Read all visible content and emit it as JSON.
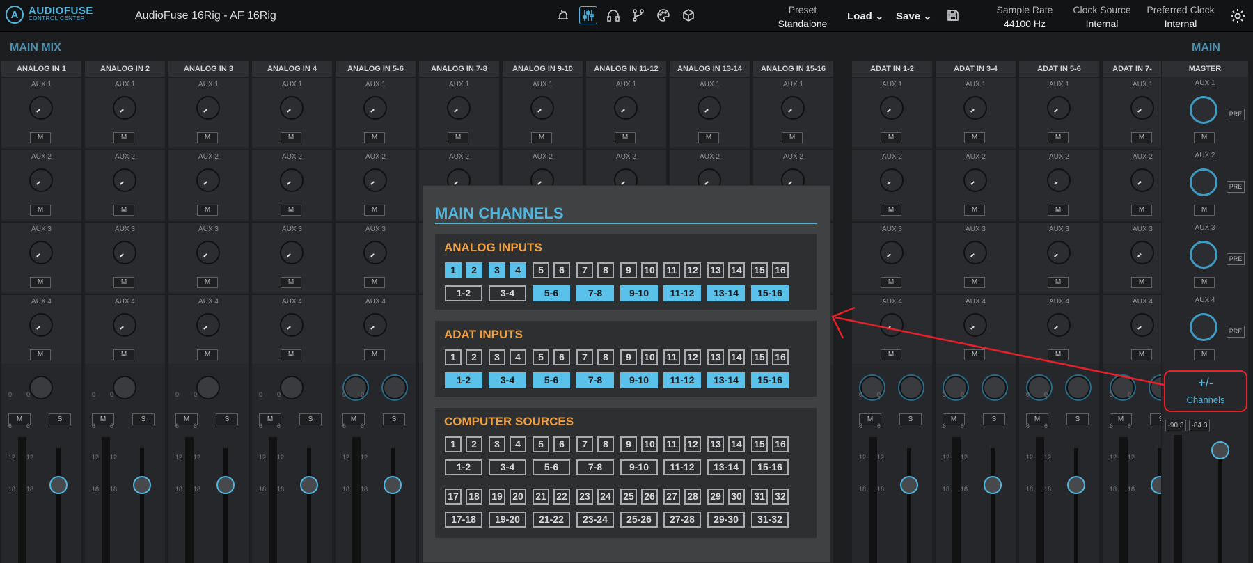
{
  "app": {
    "logo_l1": "AUDIOFUSE",
    "logo_l2": "CONTROL CENTER",
    "logo_mark": "A",
    "title": "AudioFuse 16Rig - AF 16Rig"
  },
  "toolbar": {
    "icons": [
      "device-icon",
      "mixer-icon",
      "headphones-icon",
      "routing-icon",
      "palette-icon",
      "cube-icon"
    ],
    "preset": {
      "label": "Preset",
      "value": "Standalone"
    },
    "load": "Load ⌄",
    "save": "Save ⌄",
    "sample_rate": {
      "label": "Sample Rate",
      "value": "44100 Hz"
    },
    "clock_source": {
      "label": "Clock Source",
      "value": "Internal"
    },
    "preferred_clock": {
      "label": "Preferred Clock",
      "value": "Internal"
    }
  },
  "main_mix": {
    "label": "MAIN MIX"
  },
  "main": {
    "label": "MAIN"
  },
  "strips": [
    "ANALOG IN 1",
    "ANALOG IN 2",
    "ANALOG IN 3",
    "ANALOG IN 4",
    "ANALOG IN 5-6",
    "ANALOG IN 7-8",
    "ANALOG IN 9-10",
    "ANALOG IN 11-12",
    "ANALOG IN 13-14",
    "ANALOG IN 15-16"
  ],
  "adat_strips": [
    "ADAT IN 1-2",
    "ADAT IN 3-4",
    "ADAT IN 5-6",
    "ADAT IN 7-"
  ],
  "aux_labels": [
    "AUX 1",
    "AUX 2",
    "AUX 3",
    "AUX 4"
  ],
  "mute": "M",
  "solo": "S",
  "scale": [
    "0",
    "6",
    "12",
    "18"
  ],
  "scale_right": [
    "0",
    "6",
    "12",
    "18"
  ],
  "master": {
    "label": "MASTER",
    "aux": [
      "AUX 1",
      "AUX 2",
      "AUX 3",
      "AUX 4"
    ],
    "pre": "PRE",
    "mute": "M",
    "meters": [
      "-90.3",
      "-84.3"
    ],
    "channels_symbol": "+/-",
    "channels_label": "Channels"
  },
  "popup": {
    "title": "MAIN CHANNELS",
    "analog": {
      "title": "ANALOG INPUTS",
      "mono": [
        "1",
        "2",
        "3",
        "4",
        "5",
        "6",
        "7",
        "8",
        "9",
        "10",
        "11",
        "12",
        "13",
        "14",
        "15",
        "16"
      ],
      "mono_on": [
        true,
        true,
        true,
        true,
        false,
        false,
        false,
        false,
        false,
        false,
        false,
        false,
        false,
        false,
        false,
        false
      ],
      "stereo": [
        "1-2",
        "3-4",
        "5-6",
        "7-8",
        "9-10",
        "11-12",
        "13-14",
        "15-16"
      ],
      "stereo_on": [
        false,
        false,
        true,
        true,
        true,
        true,
        true,
        true
      ]
    },
    "adat": {
      "title": "ADAT INPUTS",
      "mono": [
        "1",
        "2",
        "3",
        "4",
        "5",
        "6",
        "7",
        "8",
        "9",
        "10",
        "11",
        "12",
        "13",
        "14",
        "15",
        "16"
      ],
      "mono_on": [
        false,
        false,
        false,
        false,
        false,
        false,
        false,
        false,
        false,
        false,
        false,
        false,
        false,
        false,
        false,
        false
      ],
      "stereo": [
        "1-2",
        "3-4",
        "5-6",
        "7-8",
        "9-10",
        "11-12",
        "13-14",
        "15-16"
      ],
      "stereo_on": [
        true,
        true,
        true,
        true,
        true,
        true,
        true,
        true
      ]
    },
    "computer": {
      "title": "COMPUTER SOURCES",
      "mono1": [
        "1",
        "2",
        "3",
        "4",
        "5",
        "6",
        "7",
        "8",
        "9",
        "10",
        "11",
        "12",
        "13",
        "14",
        "15",
        "16"
      ],
      "stereo1": [
        "1-2",
        "3-4",
        "5-6",
        "7-8",
        "9-10",
        "11-12",
        "13-14",
        "15-16"
      ],
      "mono2": [
        "17",
        "18",
        "19",
        "20",
        "21",
        "22",
        "23",
        "24",
        "25",
        "26",
        "27",
        "28",
        "29",
        "30",
        "31",
        "32"
      ],
      "stereo2": [
        "17-18",
        "19-20",
        "21-22",
        "23-24",
        "25-26",
        "27-28",
        "29-30",
        "31-32"
      ]
    }
  },
  "colors": {
    "accent": "#4fb6e0",
    "orange": "#f0a040",
    "annotation": "#e8202a"
  }
}
